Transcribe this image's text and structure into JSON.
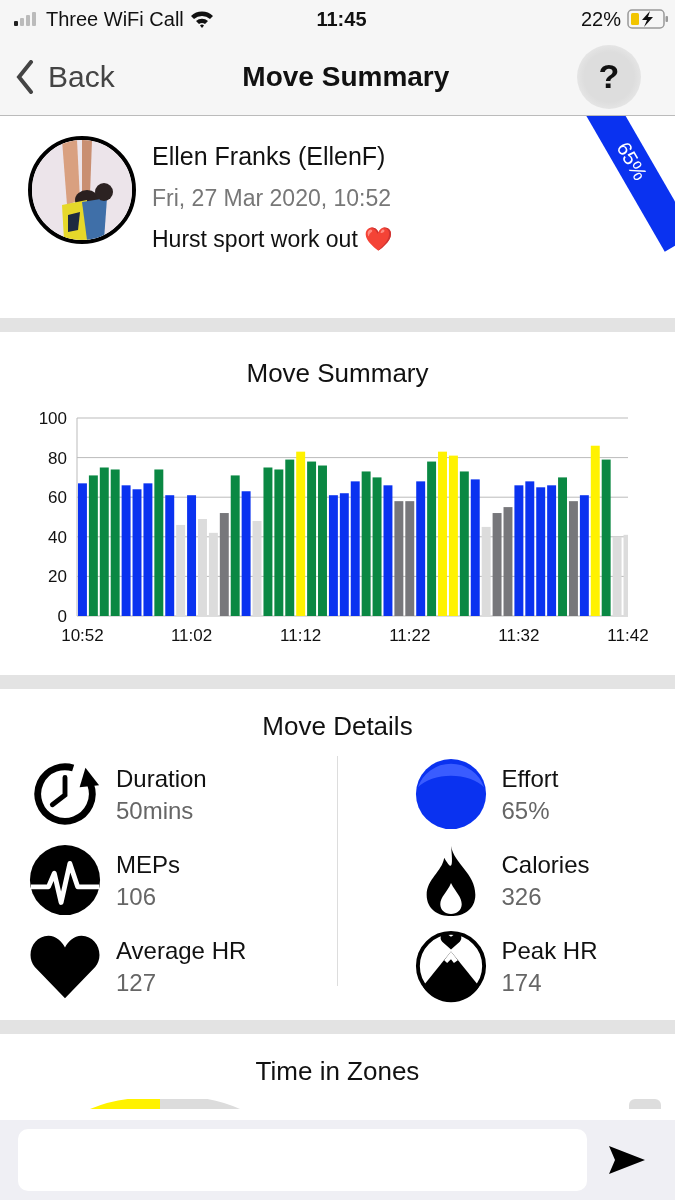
{
  "status_bar": {
    "carrier": "Three WiFi Call",
    "time": "11:45",
    "battery": "22%"
  },
  "nav": {
    "back": "Back",
    "title": "Move Summary",
    "help": "?"
  },
  "profile": {
    "name": "Ellen Franks (EllenF)",
    "date": "Fri, 27 Mar 2020, 10:52",
    "note": "Hurst sport work out ❤️",
    "ribbon": "65%"
  },
  "summary": {
    "title": "Move Summary",
    "chart_data": {
      "type": "bar",
      "grid": true,
      "categories": [
        "10:52",
        null,
        null,
        null,
        null,
        null,
        null,
        null,
        null,
        null,
        "11:02",
        null,
        null,
        null,
        null,
        null,
        null,
        null,
        null,
        null,
        "11:12",
        null,
        null,
        null,
        null,
        null,
        null,
        null,
        null,
        null,
        "11:22",
        null,
        null,
        null,
        null,
        null,
        null,
        null,
        null,
        null,
        "11:32",
        null,
        null,
        null,
        null,
        null,
        null,
        null,
        null,
        null,
        "11:42"
      ],
      "series": [
        {
          "color": "#dcdcdc",
          "values": [
            null,
            null,
            null,
            null,
            null,
            null,
            null,
            null,
            null,
            46,
            null,
            49,
            42,
            null,
            null,
            null,
            48,
            null,
            null,
            null,
            null,
            null,
            null,
            null,
            null,
            null,
            null,
            null,
            null,
            null,
            null,
            null,
            null,
            null,
            null,
            null,
            null,
            45,
            null,
            null,
            null,
            null,
            null,
            null,
            null,
            null,
            null,
            null,
            null,
            40,
            41
          ]
        },
        {
          "color": "#77777b",
          "values": [
            null,
            null,
            null,
            null,
            null,
            null,
            null,
            null,
            null,
            null,
            null,
            null,
            null,
            52,
            null,
            null,
            null,
            null,
            null,
            null,
            null,
            null,
            null,
            null,
            null,
            null,
            null,
            null,
            null,
            58,
            58,
            null,
            null,
            null,
            null,
            null,
            null,
            null,
            52,
            55,
            null,
            null,
            null,
            null,
            null,
            58,
            null,
            null,
            null,
            null,
            null
          ]
        },
        {
          "color": "#0a32f0",
          "values": [
            67,
            null,
            null,
            null,
            66,
            64,
            67,
            null,
            61,
            null,
            61,
            null,
            null,
            null,
            null,
            63,
            null,
            null,
            null,
            null,
            null,
            null,
            null,
            61,
            62,
            68,
            null,
            null,
            66,
            null,
            null,
            68,
            null,
            null,
            null,
            null,
            69,
            null,
            null,
            null,
            66,
            68,
            65,
            66,
            null,
            null,
            61,
            null,
            null,
            null,
            null
          ]
        },
        {
          "color": "#0a8843",
          "values": [
            null,
            71,
            75,
            74,
            null,
            null,
            null,
            74,
            null,
            null,
            null,
            null,
            null,
            null,
            71,
            null,
            null,
            75,
            74,
            79,
            null,
            78,
            76,
            null,
            null,
            null,
            73,
            70,
            null,
            null,
            null,
            null,
            78,
            null,
            null,
            73,
            null,
            null,
            null,
            null,
            null,
            null,
            null,
            null,
            70,
            null,
            null,
            null,
            79,
            null,
            null
          ]
        },
        {
          "color": "#fff200",
          "values": [
            null,
            null,
            null,
            null,
            null,
            null,
            null,
            null,
            null,
            null,
            null,
            null,
            null,
            null,
            null,
            null,
            null,
            null,
            null,
            null,
            83,
            null,
            null,
            null,
            null,
            null,
            null,
            null,
            null,
            null,
            null,
            null,
            null,
            83,
            81,
            null,
            null,
            null,
            null,
            null,
            null,
            null,
            null,
            null,
            null,
            null,
            null,
            86,
            null,
            null,
            null
          ]
        }
      ],
      "ylim": [
        0,
        100
      ],
      "yticks": [
        0,
        20,
        40,
        60,
        80,
        100
      ]
    }
  },
  "details": {
    "title": "Move Details",
    "items": [
      {
        "kind": "clock",
        "label": "Duration",
        "value": "50mins"
      },
      {
        "kind": "ball",
        "label": "Effort",
        "value": "65%"
      },
      {
        "kind": "pulse",
        "label": "MEPs",
        "value": "106"
      },
      {
        "kind": "flame",
        "label": "Calories",
        "value": "326"
      },
      {
        "kind": "heart",
        "label": "Average HR",
        "value": "127"
      },
      {
        "kind": "mountain",
        "label": "Peak HR",
        "value": "174"
      }
    ]
  },
  "zones": {
    "title": "Time in Zones"
  }
}
